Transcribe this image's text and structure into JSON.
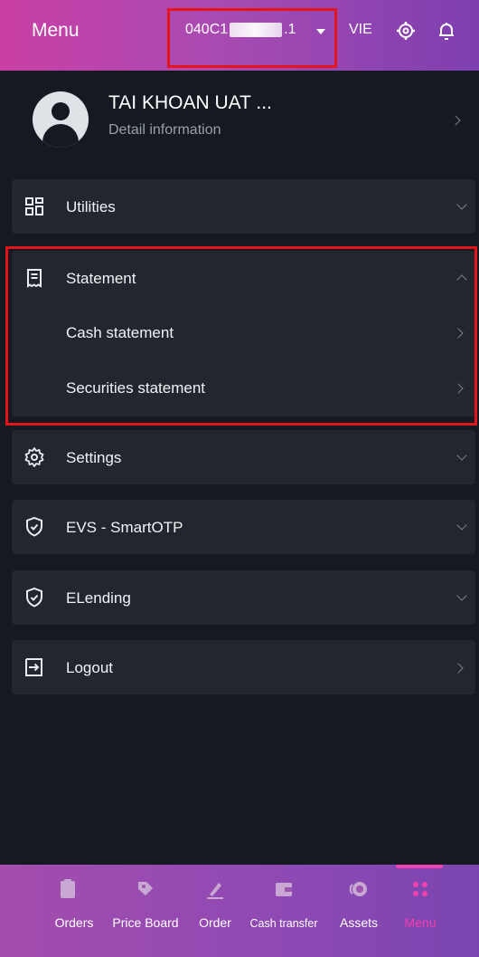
{
  "header": {
    "title": "Menu",
    "account_prefix": "040C1",
    "account_suffix": ".1",
    "language": "VIE"
  },
  "profile": {
    "name": "TAI KHOAN UAT ...",
    "subtitle": "Detail information"
  },
  "menu": {
    "utilities": "Utilities",
    "statement": "Statement",
    "statement_items": [
      "Cash statement",
      "Securities statement"
    ],
    "settings": "Settings",
    "smartotp": "EVS - SmartOTP",
    "elending": "ELending",
    "logout": "Logout"
  },
  "bottom_nav": {
    "items": [
      "Orders",
      "Price Board",
      "Order",
      "Cash transfer",
      "Assets",
      "Menu"
    ],
    "active": "Menu"
  },
  "colors": {
    "highlight": "#e3141b",
    "active_nav": "#f041ad",
    "header_gradient_start": "#c93fa5"
  }
}
